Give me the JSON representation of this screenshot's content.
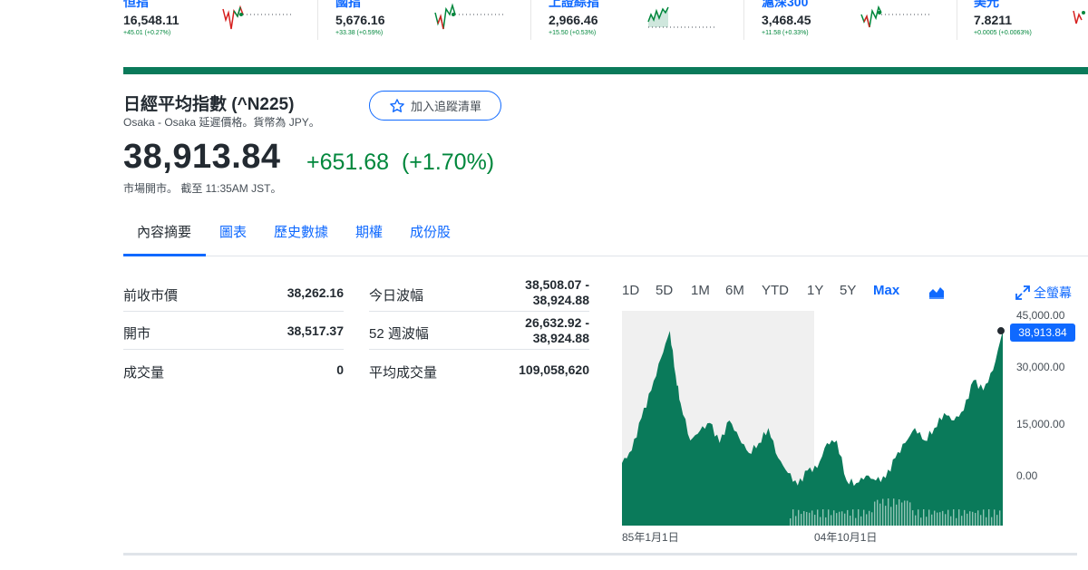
{
  "tickers": [
    {
      "name": "恒指",
      "price": "16,548.11",
      "change": "+45.01 (+0.27%)"
    },
    {
      "name": "國指",
      "price": "5,676.16",
      "change": "+33.38 (+0.59%)"
    },
    {
      "name": "上證綜指",
      "price": "2,966.46",
      "change": "+15.50 (+0.53%)"
    },
    {
      "name": "滬深300",
      "price": "3,468.45",
      "change": "+11.58 (+0.33%)"
    },
    {
      "name": "美元",
      "price": "7.8211",
      "change": "+0.0005 (+0.0063%)"
    }
  ],
  "quote": {
    "title": "日經平均指數 (^N225)",
    "subtitle": "Osaka - Osaka 延遲價格。貨幣為 JPY。",
    "watch_label": "加入追蹤清單",
    "price": "38,913.84",
    "change": "+651.68",
    "change_pct": "(+1.70%)",
    "market_status": "市場開市。 截至 11:35AM JST。"
  },
  "tabs": [
    "內容摘要",
    "圖表",
    "歷史數據",
    "期權",
    "成份股"
  ],
  "stats_left": [
    {
      "label": "前收市價",
      "value": "38,262.16"
    },
    {
      "label": "開市",
      "value": "38,517.37"
    },
    {
      "label": "成交量",
      "value": "0"
    }
  ],
  "stats_right": [
    {
      "label": "今日波幅",
      "value1": "38,508.07 -",
      "value2": "38,924.88"
    },
    {
      "label": "52 週波幅",
      "value1": "26,632.92 -",
      "value2": "38,924.88"
    },
    {
      "label": "平均成交量",
      "value1": "109,058,620",
      "value2": ""
    }
  ],
  "chart": {
    "ranges": [
      "1D",
      "5D",
      "1M",
      "6M",
      "YTD",
      "1Y",
      "5Y",
      "Max"
    ],
    "selected_range": "Max",
    "fullscreen_label": "全螢幕",
    "current_value_tag": "38,913.84",
    "accent_color": "#0f69ff",
    "fill_color": "#0a7a5a"
  },
  "chart_data": {
    "type": "area",
    "y_tick_labels": [
      "45,000.00",
      "30,000.00",
      "15,000.00",
      "0.00"
    ],
    "x_tick_labels": [
      "85年1月1日",
      "04年10月1日"
    ],
    "ylim": [
      0,
      45000
    ],
    "x": [
      1985,
      1986,
      1987,
      1988,
      1989,
      1989.9,
      1990.5,
      1991,
      1992,
      1993,
      1994,
      1995,
      1996,
      1997,
      1998,
      1999,
      2000,
      2001,
      2002,
      2003,
      2004,
      2005,
      2006,
      2007,
      2008,
      2009,
      2010,
      2011,
      2012,
      2013,
      2014,
      2015,
      2016,
      2017,
      2018,
      2019,
      2020,
      2021,
      2022,
      2023,
      2024
    ],
    "values": [
      12500,
      15000,
      21500,
      27000,
      33500,
      38900,
      30000,
      24500,
      17000,
      19000,
      20500,
      16500,
      21000,
      17500,
      14500,
      16500,
      19500,
      13500,
      10500,
      8000,
      11000,
      11500,
      16500,
      17000,
      9000,
      8500,
      10000,
      9000,
      9500,
      13500,
      16500,
      19500,
      17000,
      19500,
      22500,
      21000,
      23000,
      29000,
      27000,
      31000,
      38914
    ]
  }
}
